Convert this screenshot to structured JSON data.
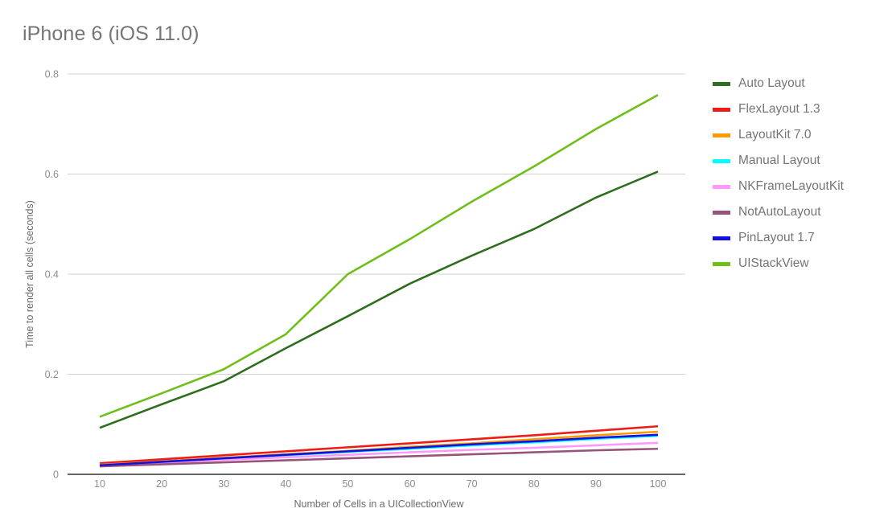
{
  "chart_data": {
    "type": "line",
    "title": "iPhone 6 (iOS 11.0)",
    "xlabel": "Number of Cells in a UICollectionView",
    "ylabel": "Time to render  all cells (seconds)",
    "x": [
      10,
      20,
      30,
      40,
      50,
      60,
      70,
      80,
      90,
      100
    ],
    "xlim": [
      10,
      100
    ],
    "ylim": [
      0,
      0.8
    ],
    "xtick_labels": [
      "10",
      "20",
      "30",
      "40",
      "50",
      "60",
      "70",
      "80",
      "90",
      "100"
    ],
    "ytick_labels": [
      "0",
      "0.2",
      "0.4",
      "0.6",
      "0.8"
    ],
    "yticks": [
      0,
      0.2,
      0.4,
      0.6,
      0.8
    ],
    "grid": "horizontal",
    "legend_position": "right",
    "series": [
      {
        "name": "Auto Layout",
        "color": "#2e6e1f",
        "values": [
          0.093,
          0.14,
          0.186,
          0.252,
          0.316,
          0.381,
          0.437,
          0.49,
          0.553,
          0.605
        ]
      },
      {
        "name": "FlexLayout 1.3",
        "color": "#ed1c16",
        "values": [
          0.022,
          0.03,
          0.038,
          0.046,
          0.054,
          0.062,
          0.07,
          0.078,
          0.087,
          0.096
        ]
      },
      {
        "name": "LayoutKit 7.0",
        "color": "#ff9900",
        "values": [
          0.019,
          0.026,
          0.033,
          0.04,
          0.047,
          0.055,
          0.062,
          0.07,
          0.078,
          0.085
        ]
      },
      {
        "name": "Manual Layout",
        "color": "#00ffff",
        "values": [
          0.017,
          0.024,
          0.031,
          0.038,
          0.045,
          0.051,
          0.058,
          0.064,
          0.071,
          0.077
        ]
      },
      {
        "name": "NKFrameLayoutKit",
        "color": "#ff99ff",
        "values": [
          0.018,
          0.023,
          0.029,
          0.034,
          0.039,
          0.044,
          0.049,
          0.053,
          0.058,
          0.063
        ]
      },
      {
        "name": "NotAutoLayout",
        "color": "#96547a",
        "values": [
          0.016,
          0.02,
          0.024,
          0.028,
          0.032,
          0.036,
          0.04,
          0.044,
          0.048,
          0.051
        ]
      },
      {
        "name": "PinLayout 1.7",
        "color": "#1010e0",
        "values": [
          0.018,
          0.025,
          0.032,
          0.039,
          0.046,
          0.053,
          0.06,
          0.066,
          0.073,
          0.079
        ]
      },
      {
        "name": "UIStackView",
        "color": "#6fbf1a",
        "values": [
          0.115,
          0.162,
          0.21,
          0.28,
          0.4,
          0.47,
          0.545,
          0.615,
          0.69,
          0.758
        ]
      }
    ]
  }
}
